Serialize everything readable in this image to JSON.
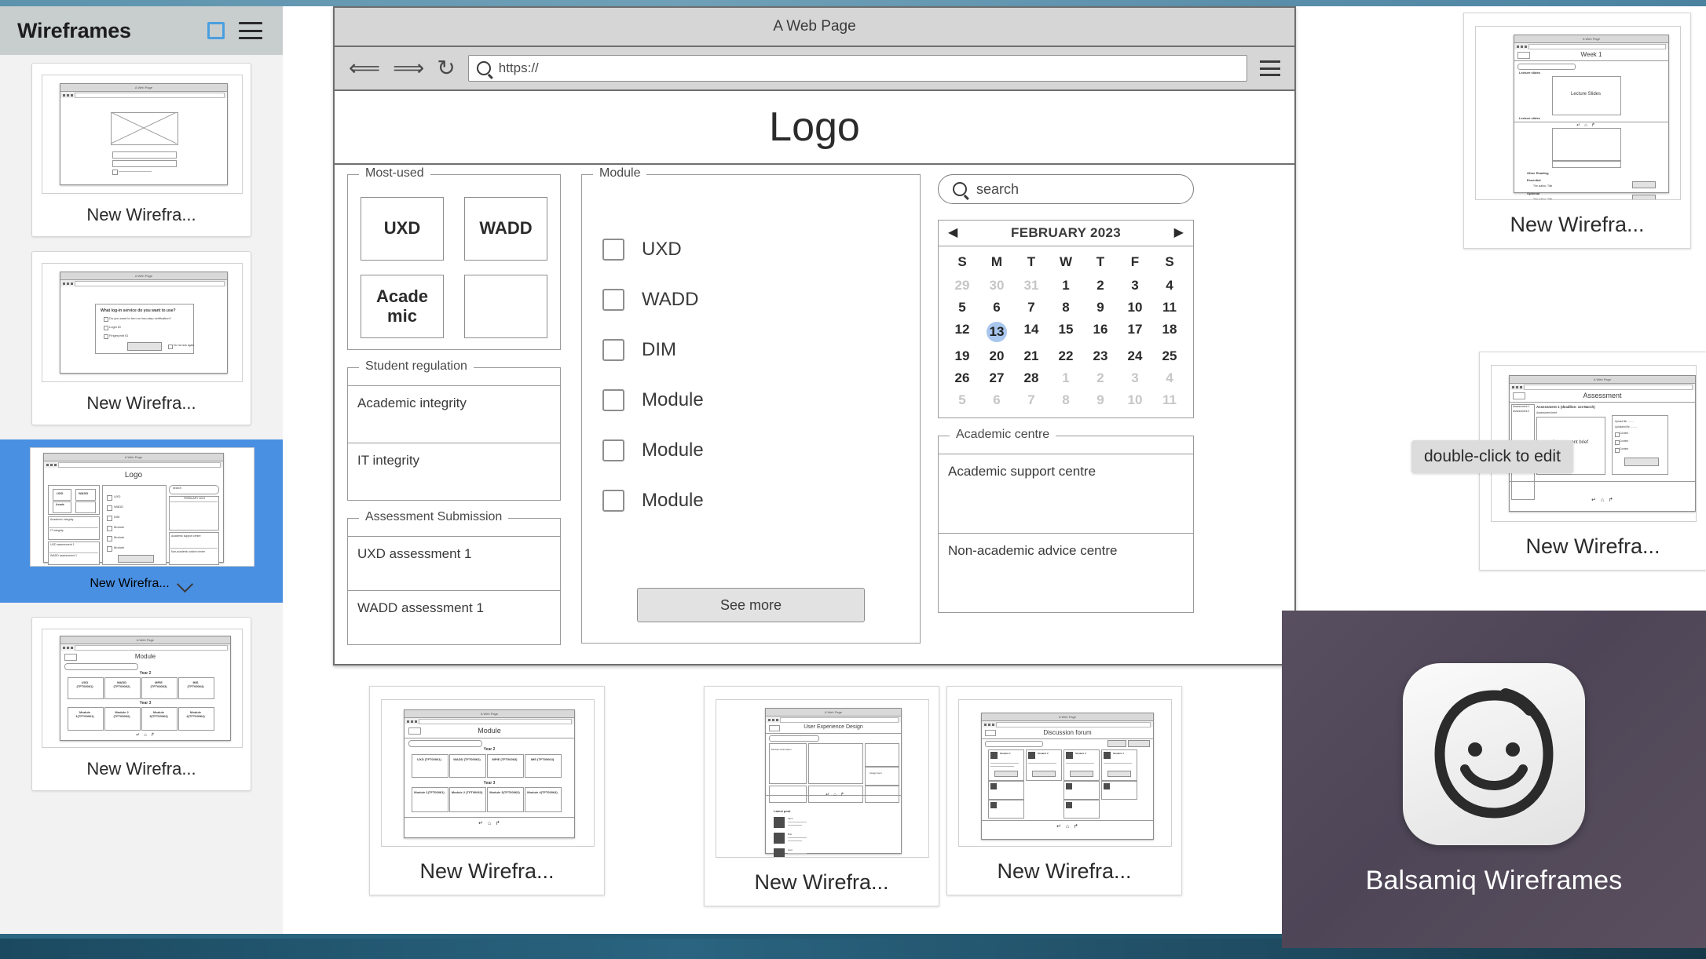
{
  "desktop": {
    "accent_blue": "#4a90e2",
    "selection_yellow": "#f5c430"
  },
  "sidebar": {
    "title": "Wireframes",
    "square_icon": "square-icon",
    "menu_icon": "hamburger-icon",
    "items": [
      {
        "label": "New Wirefra...",
        "selected": false,
        "preview": "login-image-form"
      },
      {
        "label": "New Wirefra...",
        "selected": false,
        "preview": "login-service-dialog"
      },
      {
        "label": "New Wirefra...",
        "selected": true,
        "preview": "home-dashboard"
      },
      {
        "label": "New Wirefra...",
        "selected": false,
        "preview": "module-years"
      }
    ]
  },
  "browser": {
    "window_title": "A Web Page",
    "back_icon": "arrow-left-icon",
    "forward_icon": "arrow-right-icon",
    "reload_icon": "reload-icon",
    "search_icon": "search-icon",
    "url_value": "https://",
    "url_placeholder": "https://",
    "menu_icon": "hamburger-icon",
    "logo": "Logo"
  },
  "page": {
    "most_used": {
      "title": "Most-used",
      "cells": [
        "UXD",
        "WADD",
        "Acade mic",
        ""
      ]
    },
    "student_regulation": {
      "title": "Student regulation",
      "rows": [
        "Academic integrity",
        "IT integrity"
      ]
    },
    "assessment_submission": {
      "title": "Assessment Submission",
      "rows": [
        "UXD assessment 1",
        "WADD assessment 1"
      ]
    },
    "module": {
      "title": "Module",
      "checkboxes": [
        {
          "label": "UXD",
          "checked": false
        },
        {
          "label": "WADD",
          "checked": false
        },
        {
          "label": "DIM",
          "checked": false
        },
        {
          "label": "Module",
          "checked": false
        },
        {
          "label": "Module",
          "checked": false
        },
        {
          "label": "Module",
          "checked": false
        }
      ],
      "see_more": "See more"
    },
    "search": {
      "placeholder": "search",
      "value": "search",
      "icon": "search-icon"
    },
    "calendar": {
      "month": "FEBRUARY 2023",
      "prev_icon": "triangle-left-icon",
      "next_icon": "triangle-right-icon",
      "dow": [
        "S",
        "M",
        "T",
        "W",
        "T",
        "F",
        "S"
      ],
      "weeks": [
        [
          {
            "d": "29",
            "m": true
          },
          {
            "d": "30",
            "m": true
          },
          {
            "d": "31",
            "m": true
          },
          {
            "d": "1"
          },
          {
            "d": "2"
          },
          {
            "d": "3"
          },
          {
            "d": "4"
          }
        ],
        [
          {
            "d": "5"
          },
          {
            "d": "6"
          },
          {
            "d": "7"
          },
          {
            "d": "8"
          },
          {
            "d": "9"
          },
          {
            "d": "10"
          },
          {
            "d": "11"
          }
        ],
        [
          {
            "d": "12"
          },
          {
            "d": "13",
            "today": true
          },
          {
            "d": "14"
          },
          {
            "d": "15"
          },
          {
            "d": "16"
          },
          {
            "d": "17"
          },
          {
            "d": "18"
          }
        ],
        [
          {
            "d": "19"
          },
          {
            "d": "20"
          },
          {
            "d": "21"
          },
          {
            "d": "22"
          },
          {
            "d": "23"
          },
          {
            "d": "24"
          },
          {
            "d": "25"
          }
        ],
        [
          {
            "d": "26"
          },
          {
            "d": "27"
          },
          {
            "d": "28"
          },
          {
            "d": "1",
            "m": true
          },
          {
            "d": "2",
            "m": true
          },
          {
            "d": "3",
            "m": true
          },
          {
            "d": "4",
            "m": true
          }
        ],
        [
          {
            "d": "5",
            "m": true
          },
          {
            "d": "6",
            "m": true
          },
          {
            "d": "7",
            "m": true
          },
          {
            "d": "8",
            "m": true
          },
          {
            "d": "9",
            "m": true
          },
          {
            "d": "10",
            "m": true
          },
          {
            "d": "11",
            "m": true
          }
        ]
      ]
    },
    "academic_centre": {
      "title": "Academic centre",
      "rows": [
        "Academic support centre",
        "Non-academic advice centre"
      ]
    }
  },
  "tooltip": {
    "text": "double-click to edit"
  },
  "right_thumbnails": [
    {
      "label": "New Wirefra...",
      "preview_title": "Week 1",
      "preview_body": "Lecture Slides"
    },
    {
      "label": "New Wirefra...",
      "preview_title": "Assessment",
      "preview_body": "Assessment brief",
      "preview_sub": "Assessment 1 (deadline: 1st March)"
    }
  ],
  "bottom_thumbnails": [
    {
      "label": "New Wirefra...",
      "preview_title": "Module",
      "year2_label": "Year 2",
      "year3_label": "Year 3",
      "year2": [
        "UXD (TFT00061)",
        "WADD (TFT00062)",
        "MPIE (TFT00063)",
        "IMS (TFT00064)"
      ],
      "year3": [
        "Module 1(TFT00061)",
        "Module 2 (TFT00062)",
        "Module 3(TFT00063)",
        "Module 4(TFT00064)"
      ]
    },
    {
      "label": "New Wirefra...",
      "preview_title": "User Experience Design"
    },
    {
      "label": "New Wirefra...",
      "preview_title": "Discussion forum"
    }
  ],
  "app_switcher": {
    "label": "Balsamiq Wireframes",
    "icon": "smiley-face-icon"
  }
}
